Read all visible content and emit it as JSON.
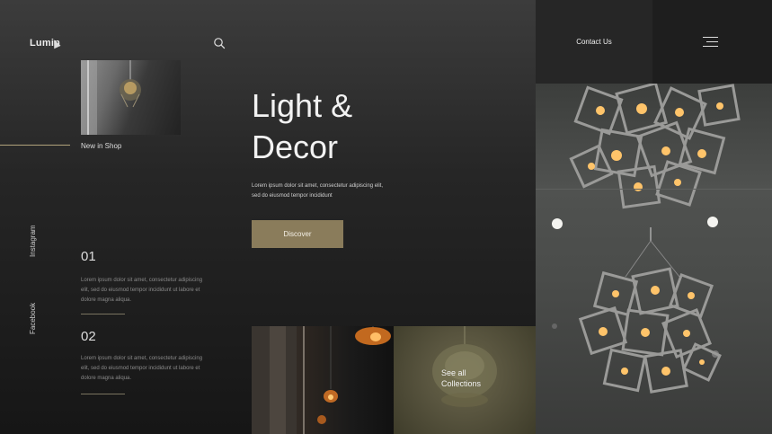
{
  "header": {
    "logo": "Lumin",
    "contact": "Contact Us"
  },
  "icons": {
    "search": "search-icon",
    "menu": "hamburger-menu-icon",
    "cursor": "mouse-cursor-icon"
  },
  "shop": {
    "label": "New in Shop"
  },
  "social": {
    "instagram": "Instagram",
    "facebook": "Facebook"
  },
  "features": [
    {
      "number": "01",
      "text": "Lorem ipsum dolor sit amet, consectetur adipiscing elit, sed do eiusmod tempor incididunt ut labore et dolore magna aliqua."
    },
    {
      "number": "02",
      "text": "Lorem ipsum dolor sit amet, consectetur adipiscing elit, sed do eiusmod tempor incididunt ut labore et dolore magna aliqua."
    }
  ],
  "hero": {
    "title_line1": "Light &",
    "title_line2": "Decor",
    "description": "Lorem ipsum dolor sit amet, consectetur adipiscing elit, sed do eiusmod tempor incididunt",
    "button": "Discover"
  },
  "collections": {
    "label_line1": "See all",
    "label_line2": "Collections"
  },
  "colors": {
    "accent": "#8a7c5b",
    "background": "#1c1c1c",
    "panel": "#262626"
  }
}
